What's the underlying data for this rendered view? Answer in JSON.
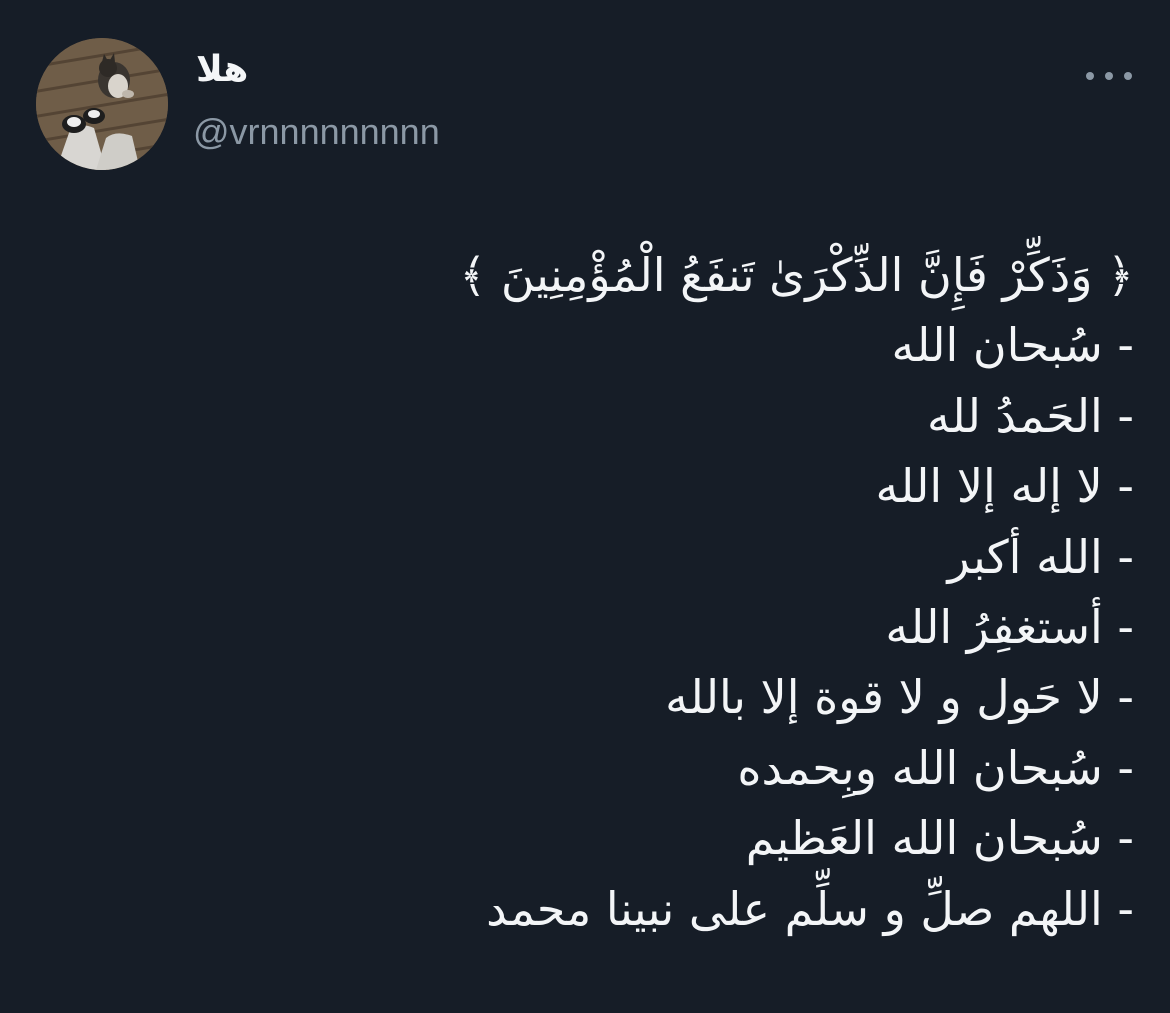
{
  "author": {
    "display_name": "هلا",
    "handle": "@vrnnnnnnnnn",
    "avatar_icon": "avatar-photo-cat-and-shoes"
  },
  "actions": {
    "more_icon": "more-horizontal-icon"
  },
  "tweet": {
    "lines": [
      "﴿ وَذَكِّرْ فَإِنَّ الذِّكْرَىٰ تَنفَعُ الْمُؤْمِنِينَ ﴾",
      "- سُبحان الله",
      "- الحَمدُ لله",
      "- لا إله إلا الله",
      "- الله أكبر",
      "- أستغفِرُ الله",
      "- لا حَول و لا قوة إلا بالله",
      "- سُبحان الله وبِحمده",
      "- سُبحان الله العَظيم",
      "- اللهم صلِّ و سلِّم على نبينا محمد"
    ]
  },
  "colors": {
    "background": "#161d27",
    "text": "#f3f5f7",
    "secondary": "#8b98a5"
  }
}
